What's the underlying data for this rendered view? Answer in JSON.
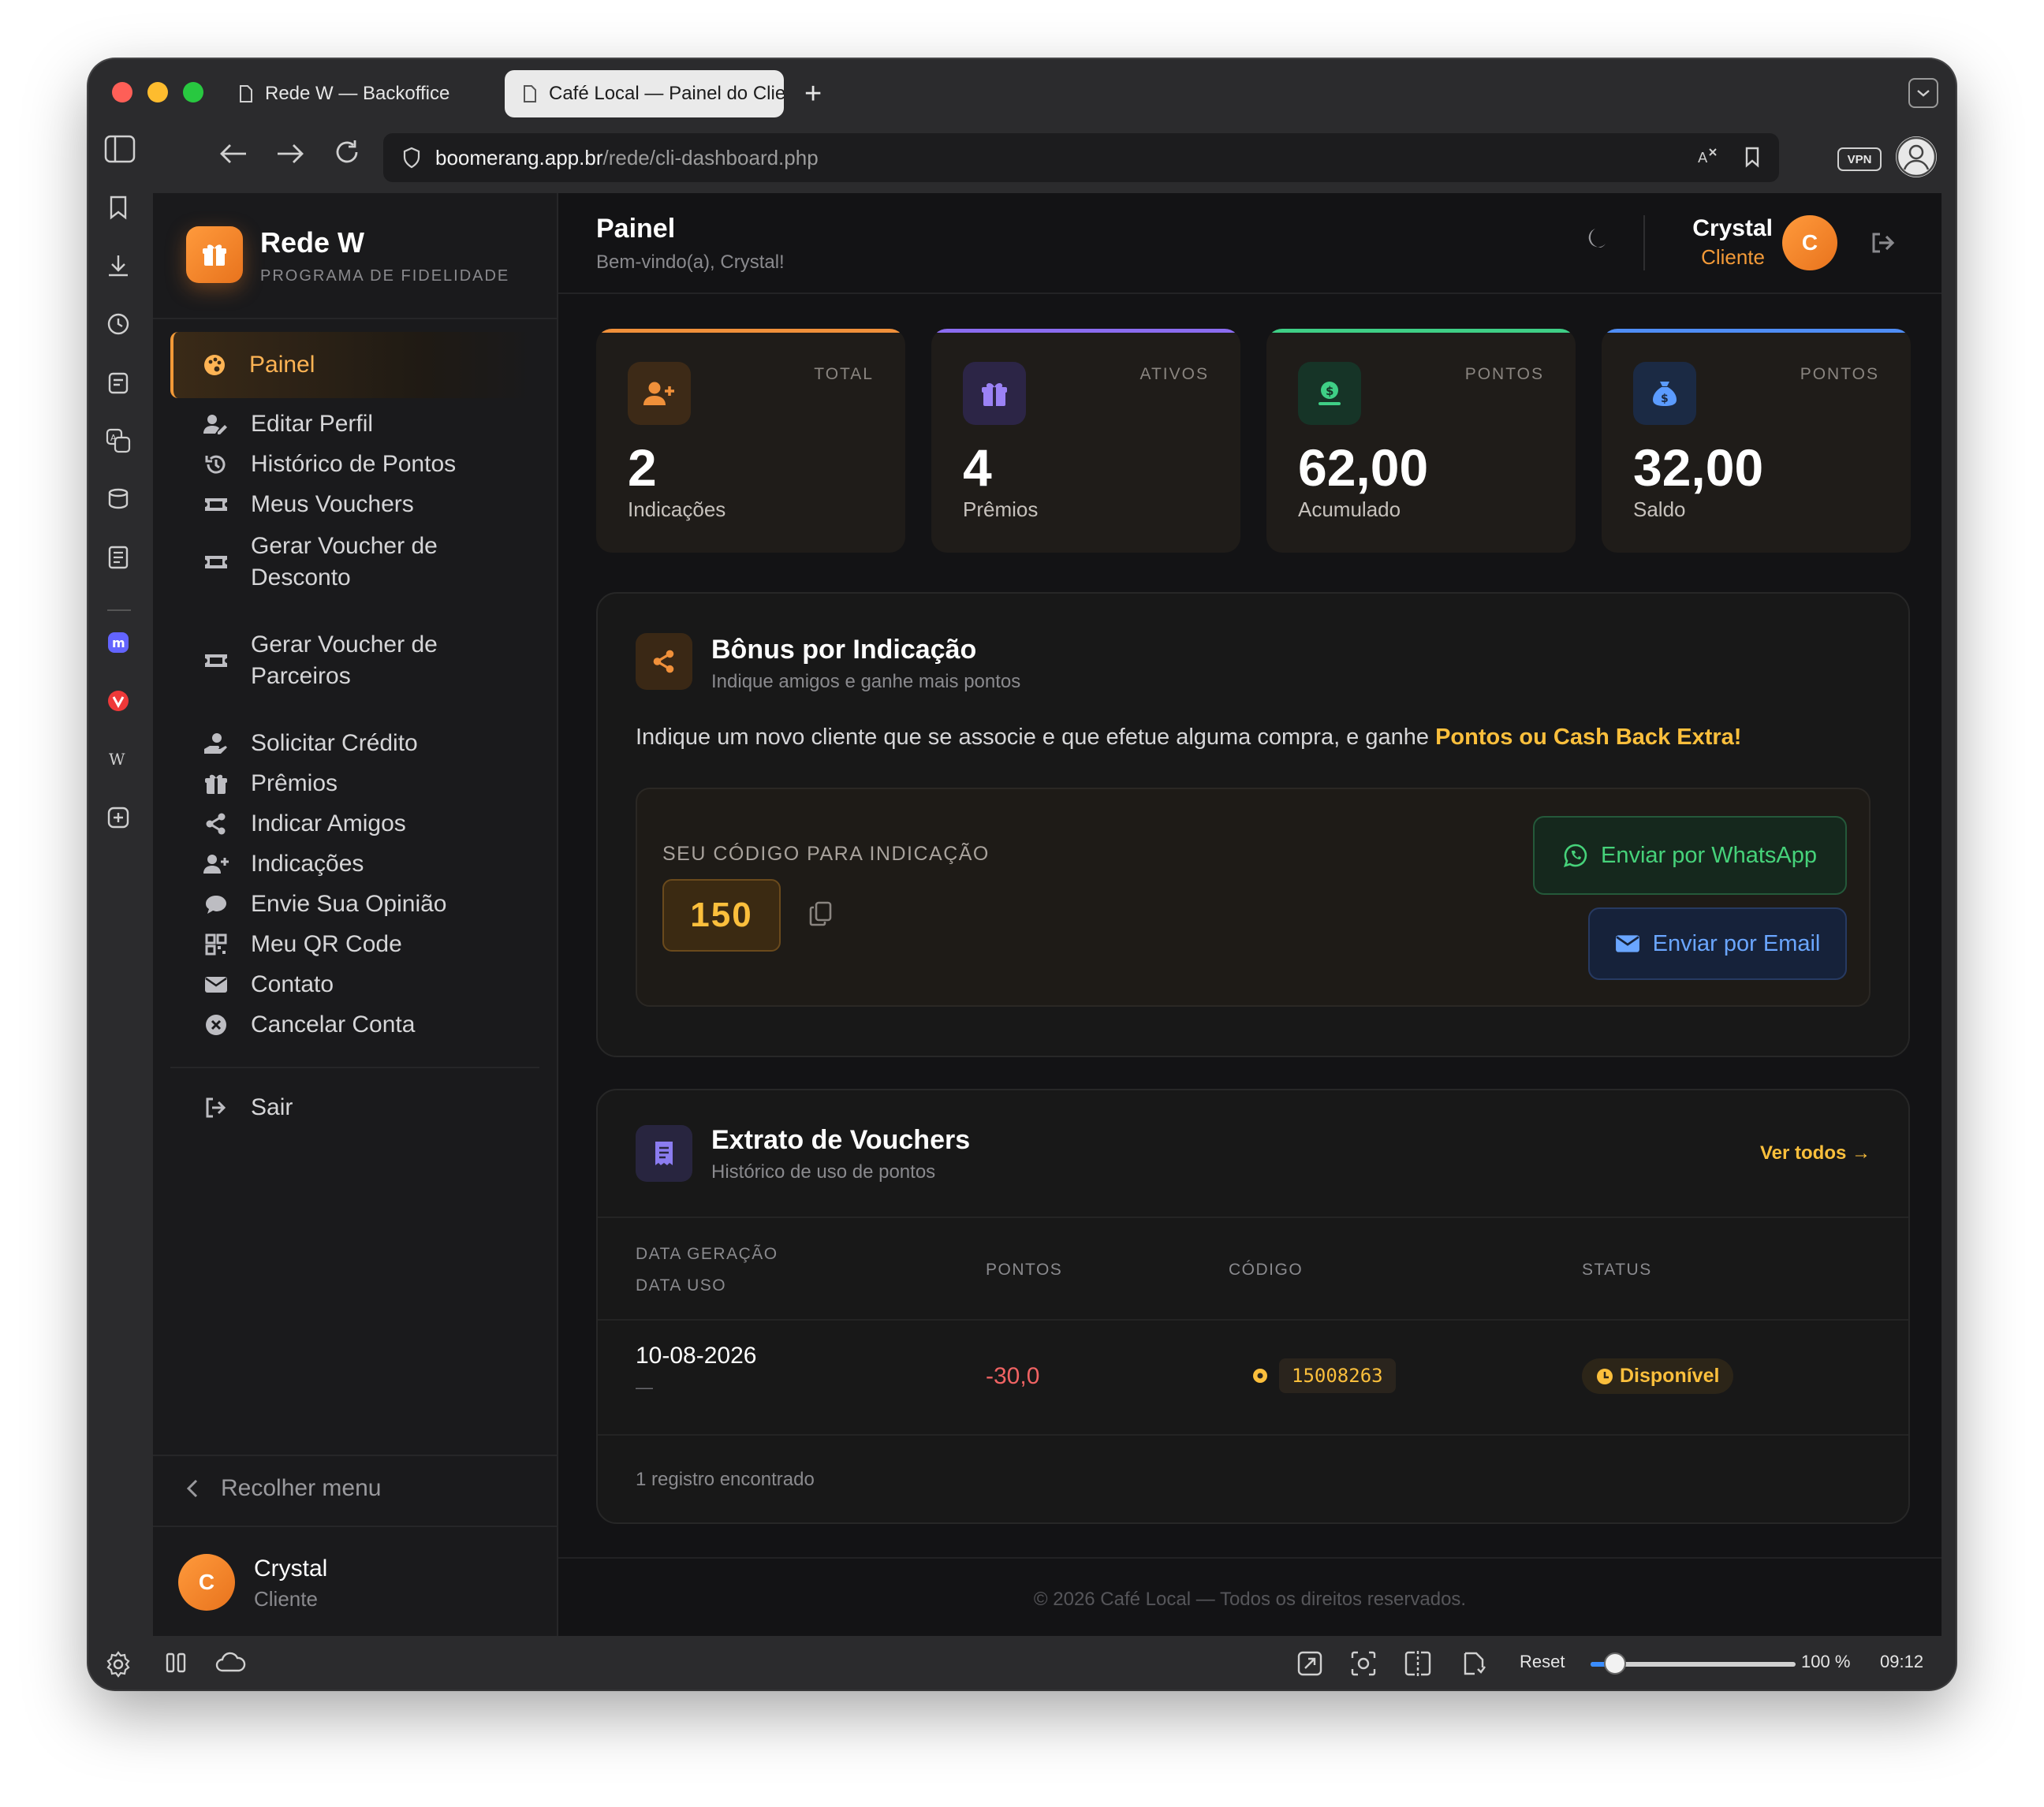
{
  "browser": {
    "tabs": [
      {
        "title": "Rede W — Backoffice",
        "active": false
      },
      {
        "title": "Café Local — Painel do Cliente",
        "active": true
      }
    ],
    "url_host": "boomerang.app.br",
    "url_path": "/rede/cli-dashboard.php",
    "vpn_label": "VPN",
    "status_bar": {
      "reset_label": "Reset",
      "zoom": "100 %",
      "zoom_level": 0.12,
      "time": "09:12"
    }
  },
  "sidebar": {
    "brand_name": "Rede W",
    "brand_subtitle": "PROGRAMA DE FIDELIDADE",
    "items": [
      {
        "label": "Painel",
        "icon": "palette-icon",
        "active": true
      },
      {
        "label": "Editar Perfil",
        "icon": "user-edit-icon"
      },
      {
        "label": "Histórico de Pontos",
        "icon": "history-icon"
      },
      {
        "label": "Meus Vouchers",
        "icon": "ticket-icon"
      },
      {
        "label": "Gerar Voucher de Desconto",
        "icon": "ticket-icon"
      },
      {
        "label": "Gerar Voucher de Parceiros",
        "icon": "ticket-icon"
      },
      {
        "label": "Solicitar Crédito",
        "icon": "hand-coin-icon"
      },
      {
        "label": "Prêmios",
        "icon": "gift-icon"
      },
      {
        "label": "Indicar Amigos",
        "icon": "share-icon"
      },
      {
        "label": "Indicações",
        "icon": "user-plus-icon"
      },
      {
        "label": "Envie Sua Opinião",
        "icon": "comment-icon"
      },
      {
        "label": "Meu QR Code",
        "icon": "qrcode-icon"
      },
      {
        "label": "Contato",
        "icon": "envelope-icon"
      },
      {
        "label": "Cancelar Conta",
        "icon": "x-circle-icon"
      }
    ],
    "logout_label": "Sair",
    "collapse_label": "Recolher menu",
    "user_initial": "C",
    "user_name": "Crystal",
    "user_role": "Cliente"
  },
  "header": {
    "title": "Painel",
    "subtitle": "Bem-vindo(a), Crystal!",
    "user_name": "Crystal",
    "user_role": "Cliente",
    "user_initial": "C"
  },
  "stats": [
    {
      "kicker": "TOTAL",
      "value": "2",
      "label": "Indicações",
      "color": "#f0903a",
      "icon": "user-plus-icon"
    },
    {
      "kicker": "ATIVOS",
      "value": "4",
      "label": "Prêmios",
      "color": "#8b6cf0",
      "icon": "gift-icon"
    },
    {
      "kicker": "PONTOS",
      "value": "62,00",
      "label": "Acumulado",
      "color": "#3fcf86",
      "icon": "money-icon"
    },
    {
      "kicker": "PONTOS",
      "value": "32,00",
      "label": "Saldo",
      "color": "#4f8df5",
      "icon": "money-bag-icon"
    }
  ],
  "referral": {
    "title": "Bônus por Indicação",
    "subtitle": "Indique amigos e ganhe mais pontos",
    "desc_text": "Indique um novo cliente que se associe e que efetue alguma compra, e ganhe ",
    "desc_highlight": "Pontos ou Cash Back Extra!",
    "code_label": "SEU CÓDIGO PARA INDICAÇÃO",
    "code": "150",
    "whatsapp_label": "Enviar por WhatsApp",
    "email_label": "Enviar por Email"
  },
  "vouchers": {
    "title": "Extrato de Vouchers",
    "subtitle": "Histórico de uso de pontos",
    "see_all": "Ver todos →",
    "columns": {
      "date_gen": "DATA GERAÇÃO",
      "date_use": "DATA USO",
      "points": "PONTOS",
      "code": "CÓDIGO",
      "status": "STATUS"
    },
    "rows": [
      {
        "date_gen": "10-08-2026",
        "date_use": "—",
        "points": "-30,0",
        "code": "15008263",
        "status": "Disponível"
      }
    ],
    "count_text": "1 registro encontrado"
  },
  "footer": "© 2026 Café Local — Todos os direitos reservados."
}
